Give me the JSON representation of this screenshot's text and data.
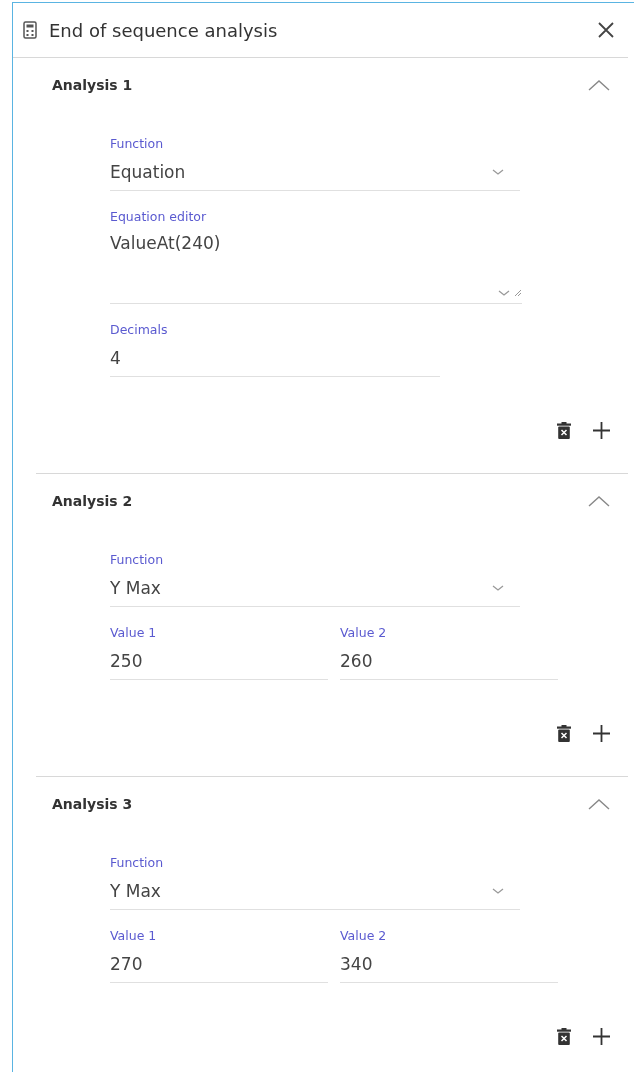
{
  "panel": {
    "title": "End of sequence analysis"
  },
  "analyses": [
    {
      "title": "Analysis 1",
      "expanded": true,
      "fields": [
        {
          "kind": "select",
          "label": "Function",
          "value": "Equation"
        },
        {
          "kind": "textarea",
          "label": "Equation editor",
          "value": "ValueAt(240)"
        },
        {
          "kind": "number",
          "label": "Decimals",
          "value": "4"
        }
      ]
    },
    {
      "title": "Analysis 2",
      "expanded": true,
      "fields": [
        {
          "kind": "select",
          "label": "Function",
          "value": "Y Max"
        },
        {
          "kind": "pair",
          "items": [
            {
              "label": "Value 1",
              "value": "250"
            },
            {
              "label": "Value 2",
              "value": "260"
            }
          ]
        }
      ]
    },
    {
      "title": "Analysis 3",
      "expanded": true,
      "fields": [
        {
          "kind": "select",
          "label": "Function",
          "value": "Y Max"
        },
        {
          "kind": "pair",
          "items": [
            {
              "label": "Value 1",
              "value": "270"
            },
            {
              "label": "Value 2",
              "value": "340"
            }
          ]
        }
      ]
    }
  ]
}
